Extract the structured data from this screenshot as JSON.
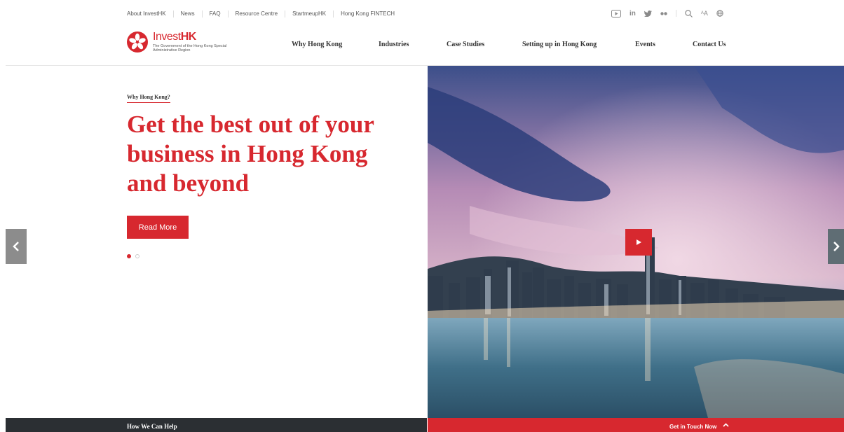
{
  "utility_links": [
    "About InvestHK",
    "News",
    "FAQ",
    "Resource Centre",
    "StartmeupHK",
    "Hong Kong FINTECH"
  ],
  "utility_icons": {
    "youtube": "youtube-icon",
    "linkedin_label": "in",
    "linkedin": "linkedin-icon",
    "twitter": "twitter-icon",
    "flickr": "flickr-icon",
    "search": "search-icon",
    "font_size_label": "AA",
    "font_size": "font-size-icon",
    "language": "globe-icon"
  },
  "logo": {
    "name_light": "Invest",
    "name_bold": "HK",
    "subtitle": "The Government of the Hong Kong Special Administrative Region"
  },
  "nav": [
    "Why Hong Kong",
    "Industries",
    "Case Studies",
    "Setting up in Hong Kong",
    "Events",
    "Contact Us"
  ],
  "hero": {
    "kicker": "Why Hong Kong?",
    "headline": "Get the best out of your business in Hong Kong and beyond",
    "cta": "Read More",
    "slides_total": 2,
    "active_slide": 1
  },
  "footer_bar": {
    "left_label": "How We Can Help",
    "right_label": "Get in Touch Now"
  },
  "colors": {
    "brand_red": "#d7282f",
    "dark_bar": "#2b2f33"
  }
}
